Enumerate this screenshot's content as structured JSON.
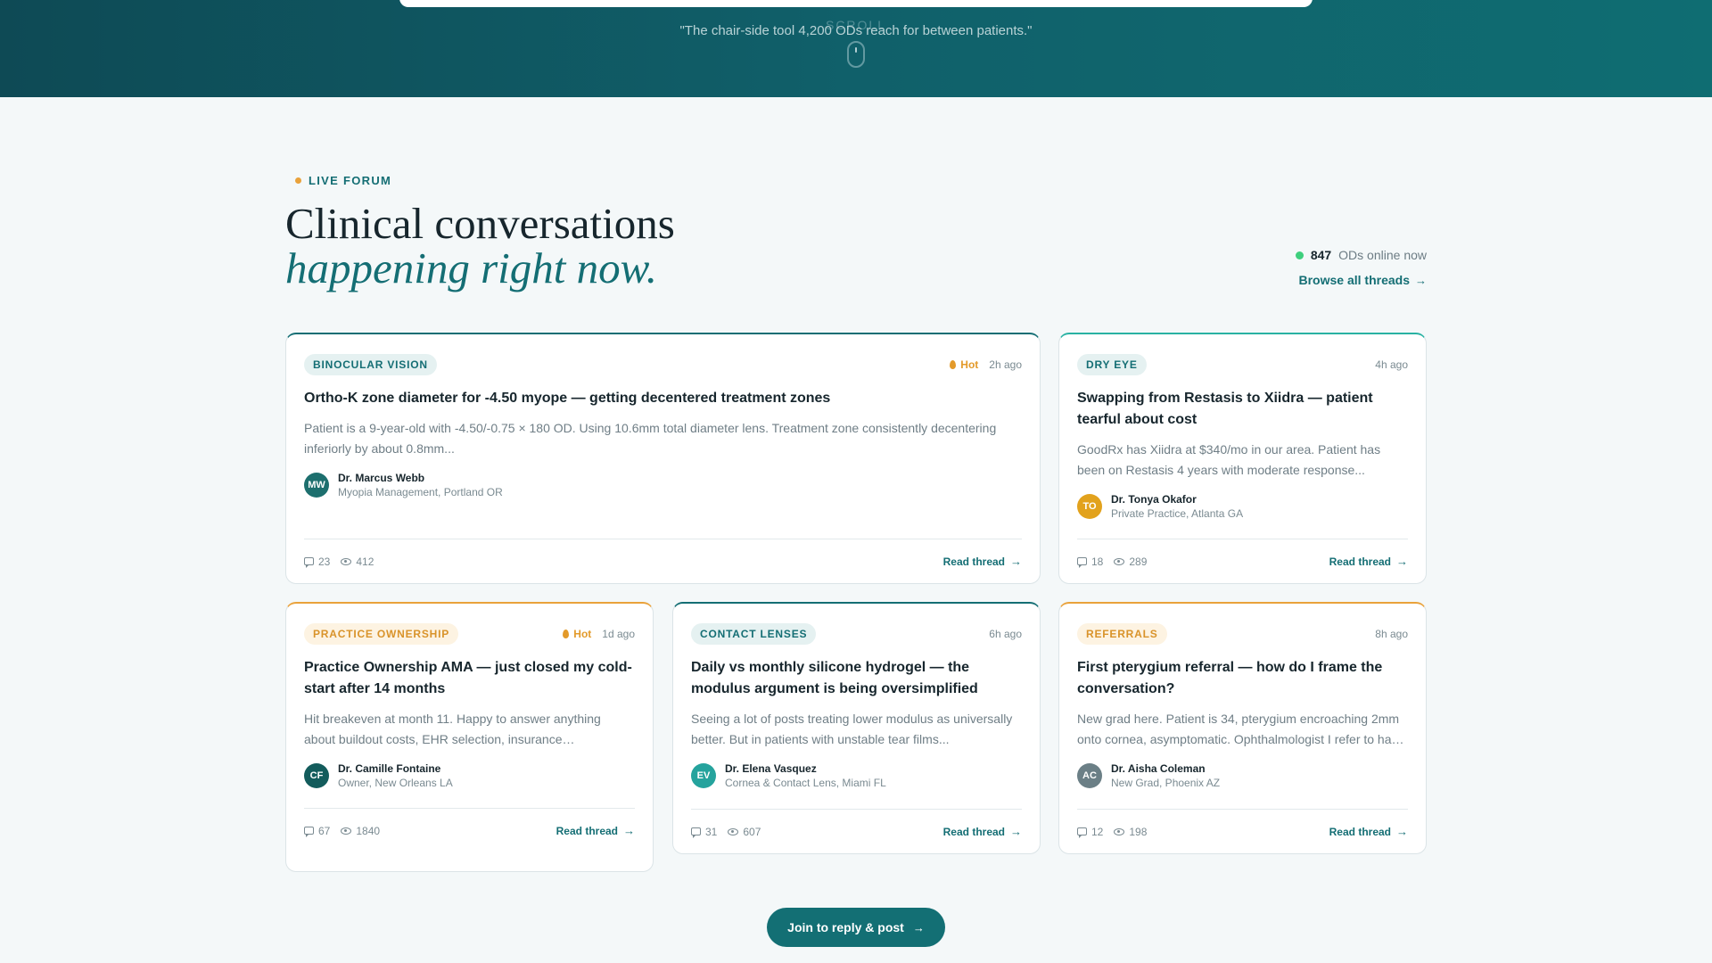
{
  "hero": {
    "quote": "\"The chair-side tool 4,200 ODs reach for between patients.\"",
    "scroll_label": "SCROLL"
  },
  "section": {
    "eyebrow": "LIVE FORUM",
    "headline": "Clinical conversations",
    "headline_accent": "happening right now.",
    "online_count": "847",
    "online_text": "ODs online now",
    "browse_label": "Browse all threads",
    "arrow": "→"
  },
  "threads": [
    {
      "tag": "BINOCULAR VISION",
      "hot": "Hot",
      "time": "2h ago",
      "title": "Ortho-K zone diameter for -4.50 myope — getting decentered treatment zones",
      "excerpt": "Patient is a 9-year-old with -4.50/-0.75 × 180 OD. Using 10.6mm total diameter lens. Treatment zone consistently decentering inferiorly by about 0.8mm...",
      "initials": "MW",
      "avatar_color": "#1d6f6e",
      "author": "Dr. Marcus Webb",
      "role": "Myopia Management, Portland OR",
      "comments": "23",
      "views": "412",
      "read_label": "Read thread"
    },
    {
      "tag": "DRY EYE",
      "time": "4h ago",
      "title": "Swapping from Restasis to Xiidra — patient tearful about cost",
      "excerpt": "GoodRx has Xiidra at $340/mo in our area. Patient has been on Restasis 4 years with moderate response...",
      "initials": "TO",
      "avatar_color": "#e2a21d",
      "author": "Dr. Tonya Okafor",
      "role": "Private Practice, Atlanta GA",
      "comments": "18",
      "views": "289",
      "read_label": "Read thread"
    },
    {
      "tag": "PRACTICE OWNERSHIP",
      "hot": "Hot",
      "time": "1d ago",
      "title": "Practice Ownership AMA — just closed my cold-start after 14 months",
      "excerpt": "Hit breakeven at month 11. Happy to answer anything about buildout costs, EHR selection, insurance…",
      "initials": "CF",
      "avatar_color": "#135c5c",
      "author": "Dr. Camille Fontaine",
      "role": "Owner, New Orleans LA",
      "comments": "67",
      "views": "1840",
      "read_label": "Read thread"
    },
    {
      "tag": "CONTACT LENSES",
      "time": "6h ago",
      "title": "Daily vs monthly silicone hydrogel — the modulus argument is being oversimplified",
      "excerpt": "Seeing a lot of posts treating lower modulus as universally better. But in patients with unstable tear films...",
      "initials": "EV",
      "avatar_color": "#25a39d",
      "author": "Dr. Elena Vasquez",
      "role": "Cornea & Contact Lens, Miami FL",
      "comments": "31",
      "views": "607",
      "read_label": "Read thread"
    },
    {
      "tag": "REFERRALS",
      "time": "8h ago",
      "title": "First pterygium referral — how do I frame the conversation?",
      "excerpt": "New grad here. Patient is 34, pterygium encroaching 2mm onto cornea, asymptomatic. Ophthalmologist I refer to ha…",
      "initials": "AC",
      "avatar_color": "#6b7f86",
      "author": "Dr. Aisha Coleman",
      "role": "New Grad, Phoenix AZ",
      "comments": "12",
      "views": "198",
      "read_label": "Read thread"
    }
  ],
  "cta": {
    "label": "Join to reply & post"
  },
  "colors": {
    "brand": "#146e74",
    "hot": "#e39a2a",
    "online": "#3ecf7d"
  }
}
